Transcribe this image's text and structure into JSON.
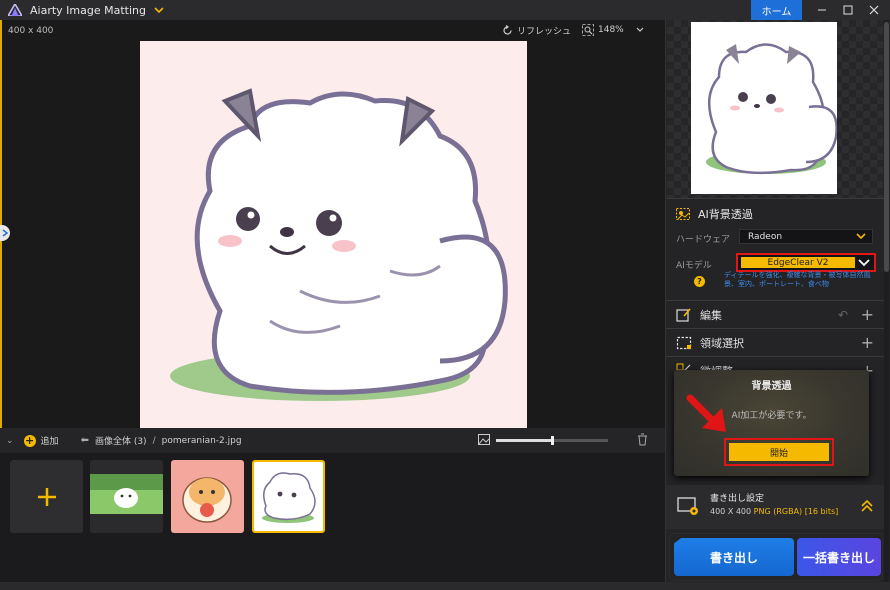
{
  "titlebar": {
    "app_title": "Aiarty Image Matting",
    "home_label": "ホーム"
  },
  "canvas": {
    "dimensions": "400 x 400",
    "refresh_label": "リフレッシュ",
    "zoom_label": "148%"
  },
  "right_panel": {
    "ai_section_title": "AI背景透過",
    "hardware_label": "ハードウェア",
    "hardware_value": "Radeon",
    "model_label": "AIモデル",
    "model_value": "EdgeClear  V2",
    "model_desc": "ディテールを強化、複雑な背景・被写体自然風景、室内、ポートレート、食べ物",
    "sections": [
      {
        "label": "編集"
      },
      {
        "label": "領域選択"
      },
      {
        "label": "微調整"
      }
    ],
    "popup": {
      "title": "背景透過",
      "message": "AI加工が必要です。",
      "start_label": "開始"
    },
    "export": {
      "title": "書き出し設定",
      "size": "400 X 400",
      "format": "PNG (RGBA) [16 bits]"
    },
    "export_button": "書き出し",
    "batch_button": "一括書き出し"
  },
  "filebar": {
    "add_label": "追加",
    "all_images_label": "画像全体 (3)",
    "separator": "/",
    "current_file": "pomeranian-2.jpg",
    "thumbnail_zoom": 0.5
  },
  "colors": {
    "accent": "#f5b900",
    "home_blue": "#1f6fd8",
    "highlight_red": "#e01515",
    "link_blue": "#3d8de8"
  },
  "icons": [
    "app-logo-icon",
    "chevron-down-icon",
    "refresh-icon",
    "zoom-icon",
    "ai-matting-icon",
    "help-icon",
    "edit-icon",
    "undo-icon",
    "selection-icon",
    "adjust-icon",
    "plus-icon",
    "export-settings-icon",
    "chevron-up-double-icon",
    "add-icon",
    "back-arrow-icon",
    "image-size-icon",
    "trash-icon",
    "sidebar-toggle-icon"
  ]
}
